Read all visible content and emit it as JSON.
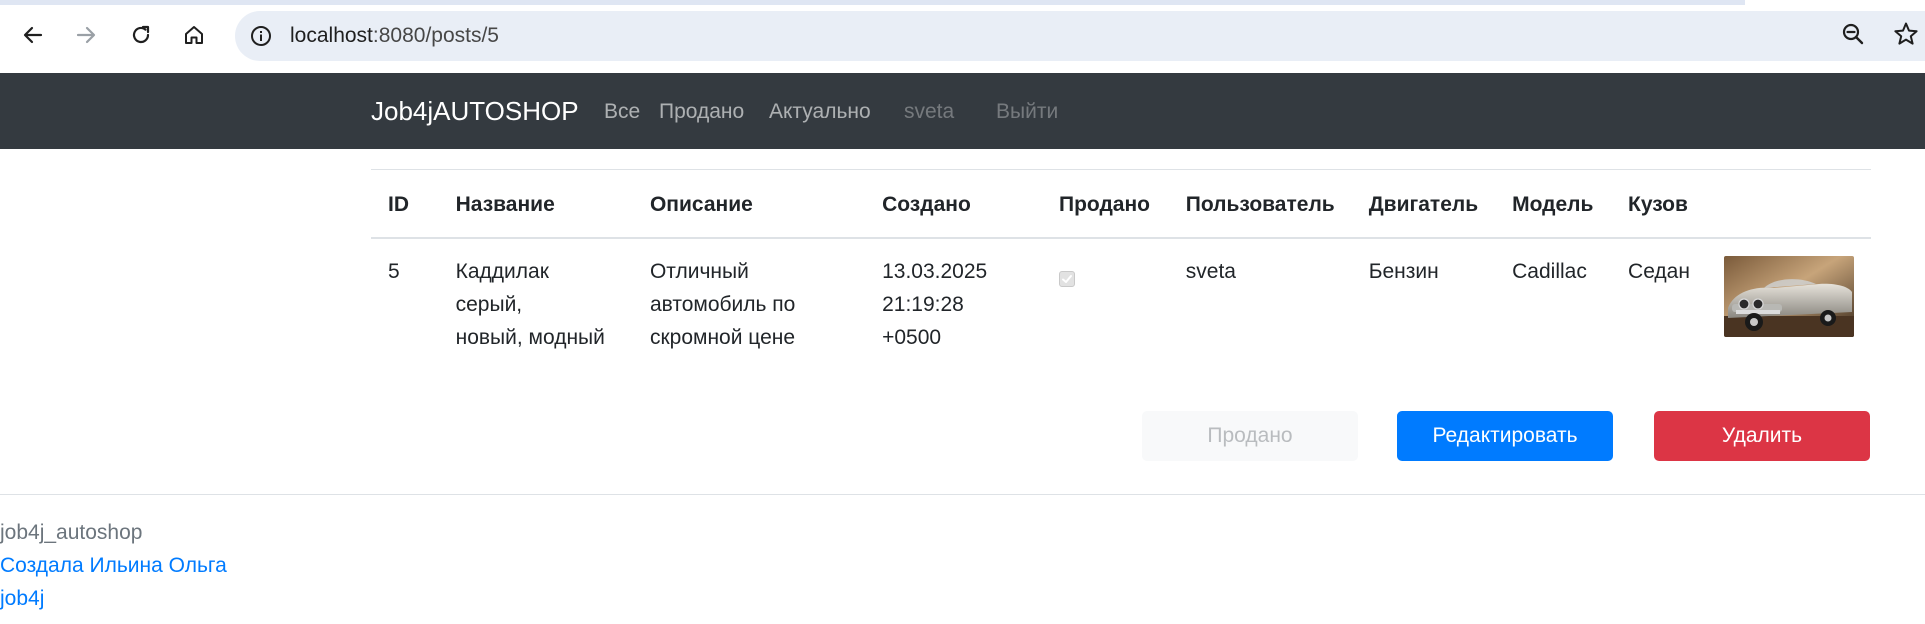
{
  "browser": {
    "url_host": "localhost",
    "url_path": ":8080/posts/5",
    "back_icon": "arrow-left-icon",
    "forward_icon": "arrow-right-icon",
    "reload_icon": "reload-icon",
    "home_icon": "home-icon",
    "info_icon": "info-icon",
    "zoom_icon": "zoom-out-icon",
    "bookmark_icon": "star-icon"
  },
  "navbar": {
    "brand": "Job4jAUTOSHOP",
    "links": [
      {
        "label": "Все"
      },
      {
        "label": "Продано"
      },
      {
        "label": "Актуально"
      },
      {
        "label": "sveta"
      },
      {
        "label": "Выйти"
      }
    ]
  },
  "table": {
    "headers": [
      "ID",
      "Название",
      "Описание",
      "Создано",
      "Продано",
      "Пользователь",
      "Двигатель",
      "Модель",
      "Кузов"
    ],
    "row": {
      "id": "5",
      "title_line1": "Каддилак серый,",
      "title_line2": "новый, модный",
      "desc_line1": "Отличный",
      "desc_line2": "автомобиль по",
      "desc_line3": "скромной цене",
      "created_line1": "13.03.2025",
      "created_line2": "21:19:28 +0500",
      "sold": true,
      "user": "sveta",
      "engine": "Бензин",
      "model": "Cadillac",
      "body": "Седан"
    }
  },
  "actions": {
    "sold_label": "Продано",
    "edit_label": "Редактировать",
    "delete_label": "Удалить"
  },
  "footer": {
    "project": "job4j_autoshop",
    "author_link": "Создала Ильина Ольга",
    "school_link": "job4j"
  },
  "colors": {
    "navbar_bg": "#343a40",
    "primary": "#007bff",
    "danger": "#dc3545"
  }
}
